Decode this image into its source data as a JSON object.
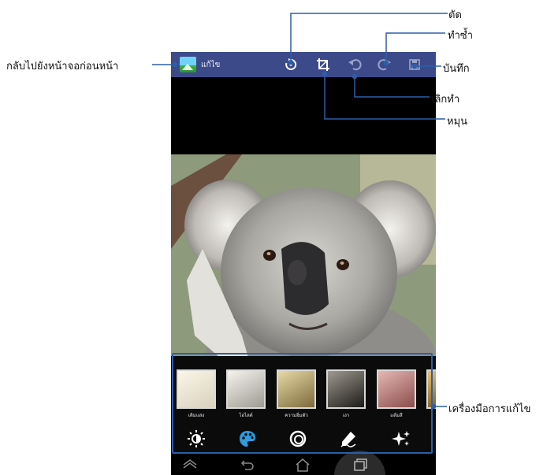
{
  "actionbar": {
    "title": "แก้ไข",
    "icons": [
      "app-icon",
      "rotate-icon",
      "crop-icon",
      "undo-icon",
      "redo-icon",
      "save-icon"
    ]
  },
  "callouts": {
    "back": "กลับไปยังหน้าจอก่อนหน้า",
    "cut": "ตัด",
    "redo": "ทำซ้ำ",
    "save": "บันทึก",
    "undo": "เลิกทำ",
    "rotate": "หมุน",
    "edit_tools": "เครื่องมือการแก้ไข"
  },
  "filters": [
    {
      "label": "เติมแสง"
    },
    {
      "label": "ไฮไลต์"
    },
    {
      "label": "ความอิ่มตัว"
    },
    {
      "label": "เงา"
    },
    {
      "label": "แต้มสี"
    }
  ],
  "tools": [
    "brightness-icon",
    "palette-icon",
    "frames-icon",
    "draw-icon",
    "effects-icon"
  ],
  "navbar": [
    "menu-icon",
    "back-icon",
    "home-icon",
    "recent-apps-icon"
  ],
  "colors": {
    "actionbar": "#3d4a8a",
    "accent": "#2b9de0",
    "callout_line": "#2b5fa8"
  }
}
